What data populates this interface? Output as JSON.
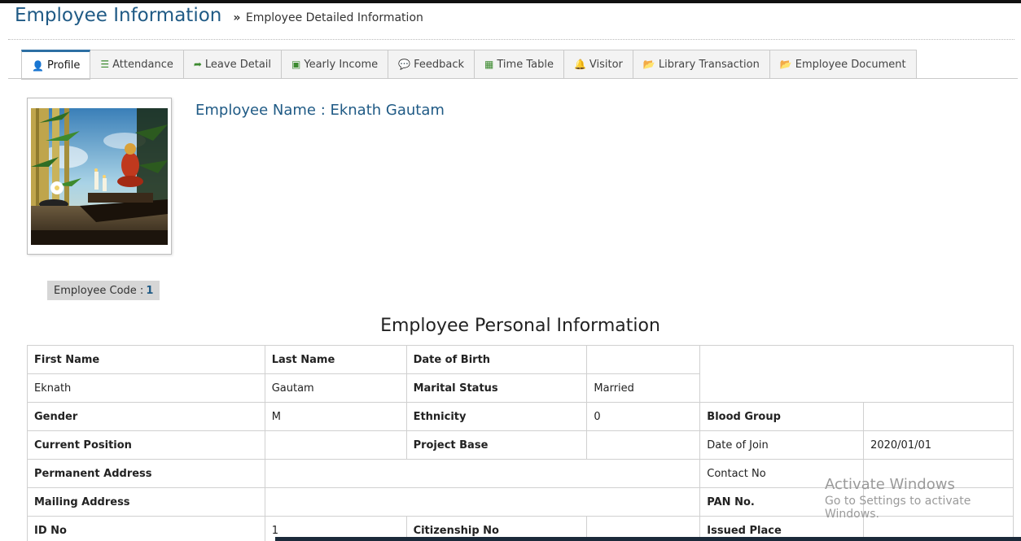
{
  "header": {
    "title": "Employee Information",
    "breadcrumb_sep": "»",
    "breadcrumb": "Employee Detailed Information"
  },
  "tabs": [
    {
      "label": "Profile",
      "icon": "user-icon",
      "glyph": "👤",
      "active": true
    },
    {
      "label": "Attendance",
      "icon": "list-icon",
      "glyph": "☰"
    },
    {
      "label": "Leave Detail",
      "icon": "share-arrow-icon",
      "glyph": "➦"
    },
    {
      "label": "Yearly Income",
      "icon": "money-icon",
      "glyph": "▣"
    },
    {
      "label": "Feedback",
      "icon": "comments-icon",
      "glyph": "💬"
    },
    {
      "label": "Time Table",
      "icon": "calendar-icon",
      "glyph": "▦"
    },
    {
      "label": "Visitor",
      "icon": "bell-icon",
      "glyph": "🔔"
    },
    {
      "label": "Library Transaction",
      "icon": "folder-open-icon",
      "glyph": "📂"
    },
    {
      "label": "Employee Document",
      "icon": "folder-open-icon",
      "glyph": "📂"
    }
  ],
  "profile": {
    "name_label": "Employee Name : Eknath Gautam",
    "code_label": "Employee Code :",
    "code_value": "1"
  },
  "section_title": "Employee Personal Information",
  "table": {
    "first_name_label": "First Name",
    "last_name_label": "Last Name",
    "dob_label": "Date of Birth",
    "dob_value": "",
    "first_name": "Eknath",
    "last_name": "Gautam",
    "marital_label": "Marital Status",
    "marital_value": "Married",
    "gender_label": "Gender",
    "gender_value": "M",
    "ethnicity_label": "Ethnicity",
    "ethnicity_value": "0",
    "blood_label": "Blood Group",
    "blood_value": "",
    "position_label": "Current Position",
    "position_value": "",
    "project_label": "Project Base",
    "project_value": "",
    "join_label": "Date of Join",
    "join_value": "2020/01/01",
    "perm_addr_label": "Permanent Address",
    "perm_addr_value": "",
    "contact_label": "Contact No",
    "contact_value": "",
    "mail_addr_label": "Mailing Address",
    "mail_addr_value": "",
    "pan_label": "PAN No.",
    "pan_value": "",
    "id_label": "ID No",
    "id_value": "1",
    "citizenship_label": "Citizenship No",
    "citizenship_value": "",
    "issued_label": "Issued Place",
    "issued_value": ""
  },
  "watermark": {
    "line1": "Activate Windows",
    "line2": "Go to Settings to activate Windows."
  }
}
